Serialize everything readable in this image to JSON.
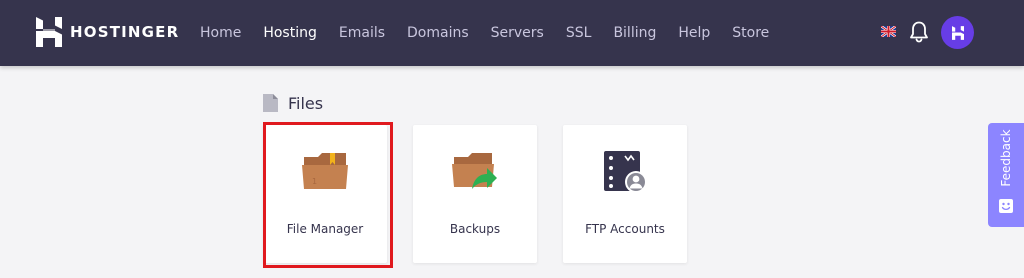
{
  "header": {
    "brand": "HOSTINGER",
    "nav": [
      {
        "label": "Home",
        "active": false
      },
      {
        "label": "Hosting",
        "active": true
      },
      {
        "label": "Emails",
        "active": false
      },
      {
        "label": "Domains",
        "active": false
      },
      {
        "label": "Servers",
        "active": false
      },
      {
        "label": "SSL",
        "active": false
      },
      {
        "label": "Billing",
        "active": false
      },
      {
        "label": "Help",
        "active": false
      },
      {
        "label": "Store",
        "active": false
      }
    ],
    "icons": {
      "language": "uk-flag-icon",
      "notifications": "bell-icon",
      "avatar": "hostinger-logo-icon"
    },
    "colors": {
      "bar": "#36344d",
      "avatar": "#673de6"
    }
  },
  "section": {
    "title": "Files",
    "cards": [
      {
        "label": "File Manager",
        "icon": "folder-icon",
        "highlighted": true
      },
      {
        "label": "Backups",
        "icon": "folder-arrow-icon",
        "highlighted": false
      },
      {
        "label": "FTP Accounts",
        "icon": "server-user-icon",
        "highlighted": false
      }
    ]
  },
  "feedback": {
    "label": "Feedback",
    "color": "#8c85ff"
  },
  "highlight_color": "#e0191e"
}
